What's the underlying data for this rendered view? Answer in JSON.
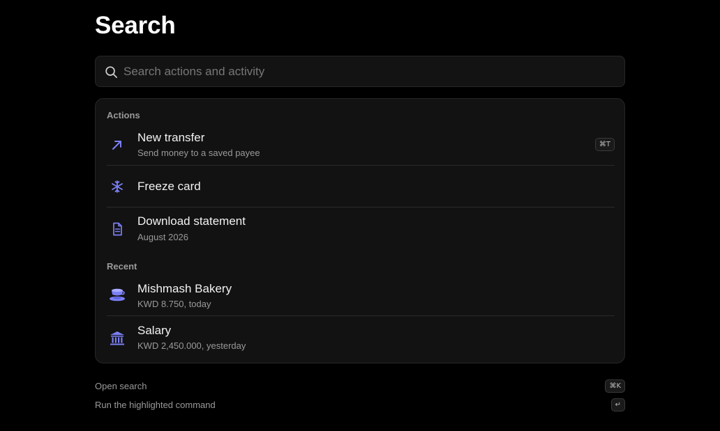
{
  "page": {
    "title": "Search"
  },
  "search": {
    "placeholder": "Search actions and activity",
    "value": ""
  },
  "actions": {
    "label": "Actions",
    "items": [
      {
        "title": "New transfer",
        "subtitle": "Send money to a saved payee",
        "shortcut": "⌘T",
        "icon": "arrow-up-right-icon"
      },
      {
        "title": "Freeze card",
        "subtitle": "",
        "icon": "snowflake-icon"
      },
      {
        "title": "Download statement",
        "subtitle": "August 2026",
        "icon": "document-icon"
      }
    ]
  },
  "recent": {
    "label": "Recent",
    "items": [
      {
        "title": "Mishmash Bakery",
        "subtitle": "KWD 8.750, today",
        "icon": "coffee-cup-icon"
      },
      {
        "title": "Salary",
        "subtitle": "KWD 2,450.000, yesterday",
        "icon": "bank-icon"
      }
    ]
  },
  "footer": {
    "hints": [
      {
        "label": "Open search",
        "key": "⌘K"
      },
      {
        "label": "Run the highlighted command",
        "key": "↵"
      }
    ]
  },
  "colors": {
    "accent": "#7b7ff5",
    "background": "#000000",
    "panel": "#121212"
  }
}
